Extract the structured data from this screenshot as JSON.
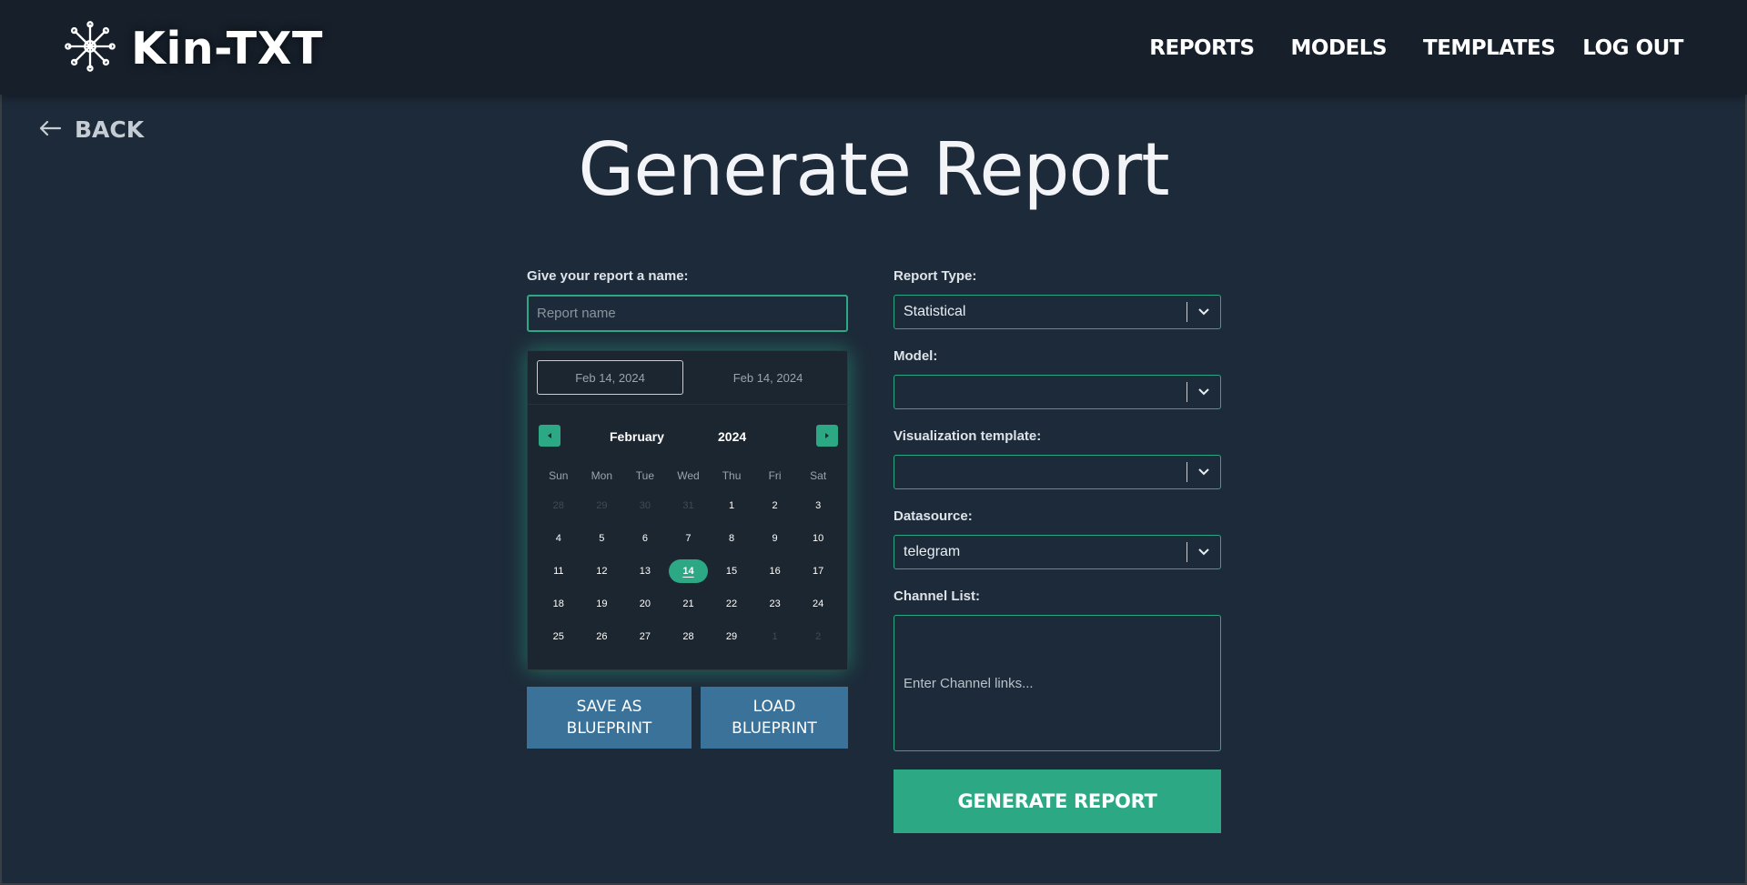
{
  "header": {
    "brand": "Kin-TXT",
    "nav": {
      "reports": "REPORTS",
      "models": "MODELS",
      "templates": "TEMPLATES",
      "logout": "LOG OUT"
    }
  },
  "back_label": "BACK",
  "page_title": "Generate Report",
  "form": {
    "name_label": "Give your report a name:",
    "name_placeholder": "Report name",
    "name_value": "",
    "report_type_label": "Report Type:",
    "report_type_value": "Statistical",
    "model_label": "Model:",
    "model_value": "",
    "template_label": "Visualization template:",
    "template_value": "",
    "datasource_label": "Datasource:",
    "datasource_value": "telegram",
    "channel_list_label": "Channel List:",
    "channel_list_placeholder": "Enter Channel links...",
    "save_blueprint_label": "SAVE AS\nBLUEPRINT",
    "load_blueprint_label": "LOAD\nBLUEPRINT",
    "generate_label": "GENERATE REPORT"
  },
  "calendar": {
    "start_date": "Feb 14, 2024",
    "end_date": "Feb 14, 2024",
    "month": "February",
    "year": "2024",
    "weekdays": [
      "Sun",
      "Mon",
      "Tue",
      "Wed",
      "Thu",
      "Fri",
      "Sat"
    ],
    "weeks": [
      [
        {
          "d": "28",
          "m": true
        },
        {
          "d": "29",
          "m": true
        },
        {
          "d": "30",
          "m": true
        },
        {
          "d": "31",
          "m": true
        },
        {
          "d": "1"
        },
        {
          "d": "2"
        },
        {
          "d": "3"
        }
      ],
      [
        {
          "d": "4"
        },
        {
          "d": "5"
        },
        {
          "d": "6"
        },
        {
          "d": "7"
        },
        {
          "d": "8"
        },
        {
          "d": "9"
        },
        {
          "d": "10"
        }
      ],
      [
        {
          "d": "11"
        },
        {
          "d": "12"
        },
        {
          "d": "13"
        },
        {
          "d": "14",
          "s": true
        },
        {
          "d": "15"
        },
        {
          "d": "16"
        },
        {
          "d": "17"
        }
      ],
      [
        {
          "d": "18"
        },
        {
          "d": "19"
        },
        {
          "d": "20"
        },
        {
          "d": "21"
        },
        {
          "d": "22"
        },
        {
          "d": "23"
        },
        {
          "d": "24"
        }
      ],
      [
        {
          "d": "25"
        },
        {
          "d": "26"
        },
        {
          "d": "27"
        },
        {
          "d": "28"
        },
        {
          "d": "29"
        },
        {
          "d": "1",
          "m": true
        },
        {
          "d": "2",
          "m": true
        }
      ]
    ]
  },
  "colors": {
    "background": "#1d2a39",
    "header": "#161f2a",
    "accent": "#2da885",
    "blueprint_button": "#3a729a"
  },
  "icons": {
    "logo": "network-node-icon",
    "back": "arrow-left-icon",
    "select": "chevron-down-icon",
    "prev_month": "caret-left-icon",
    "next_month": "caret-right-icon"
  }
}
